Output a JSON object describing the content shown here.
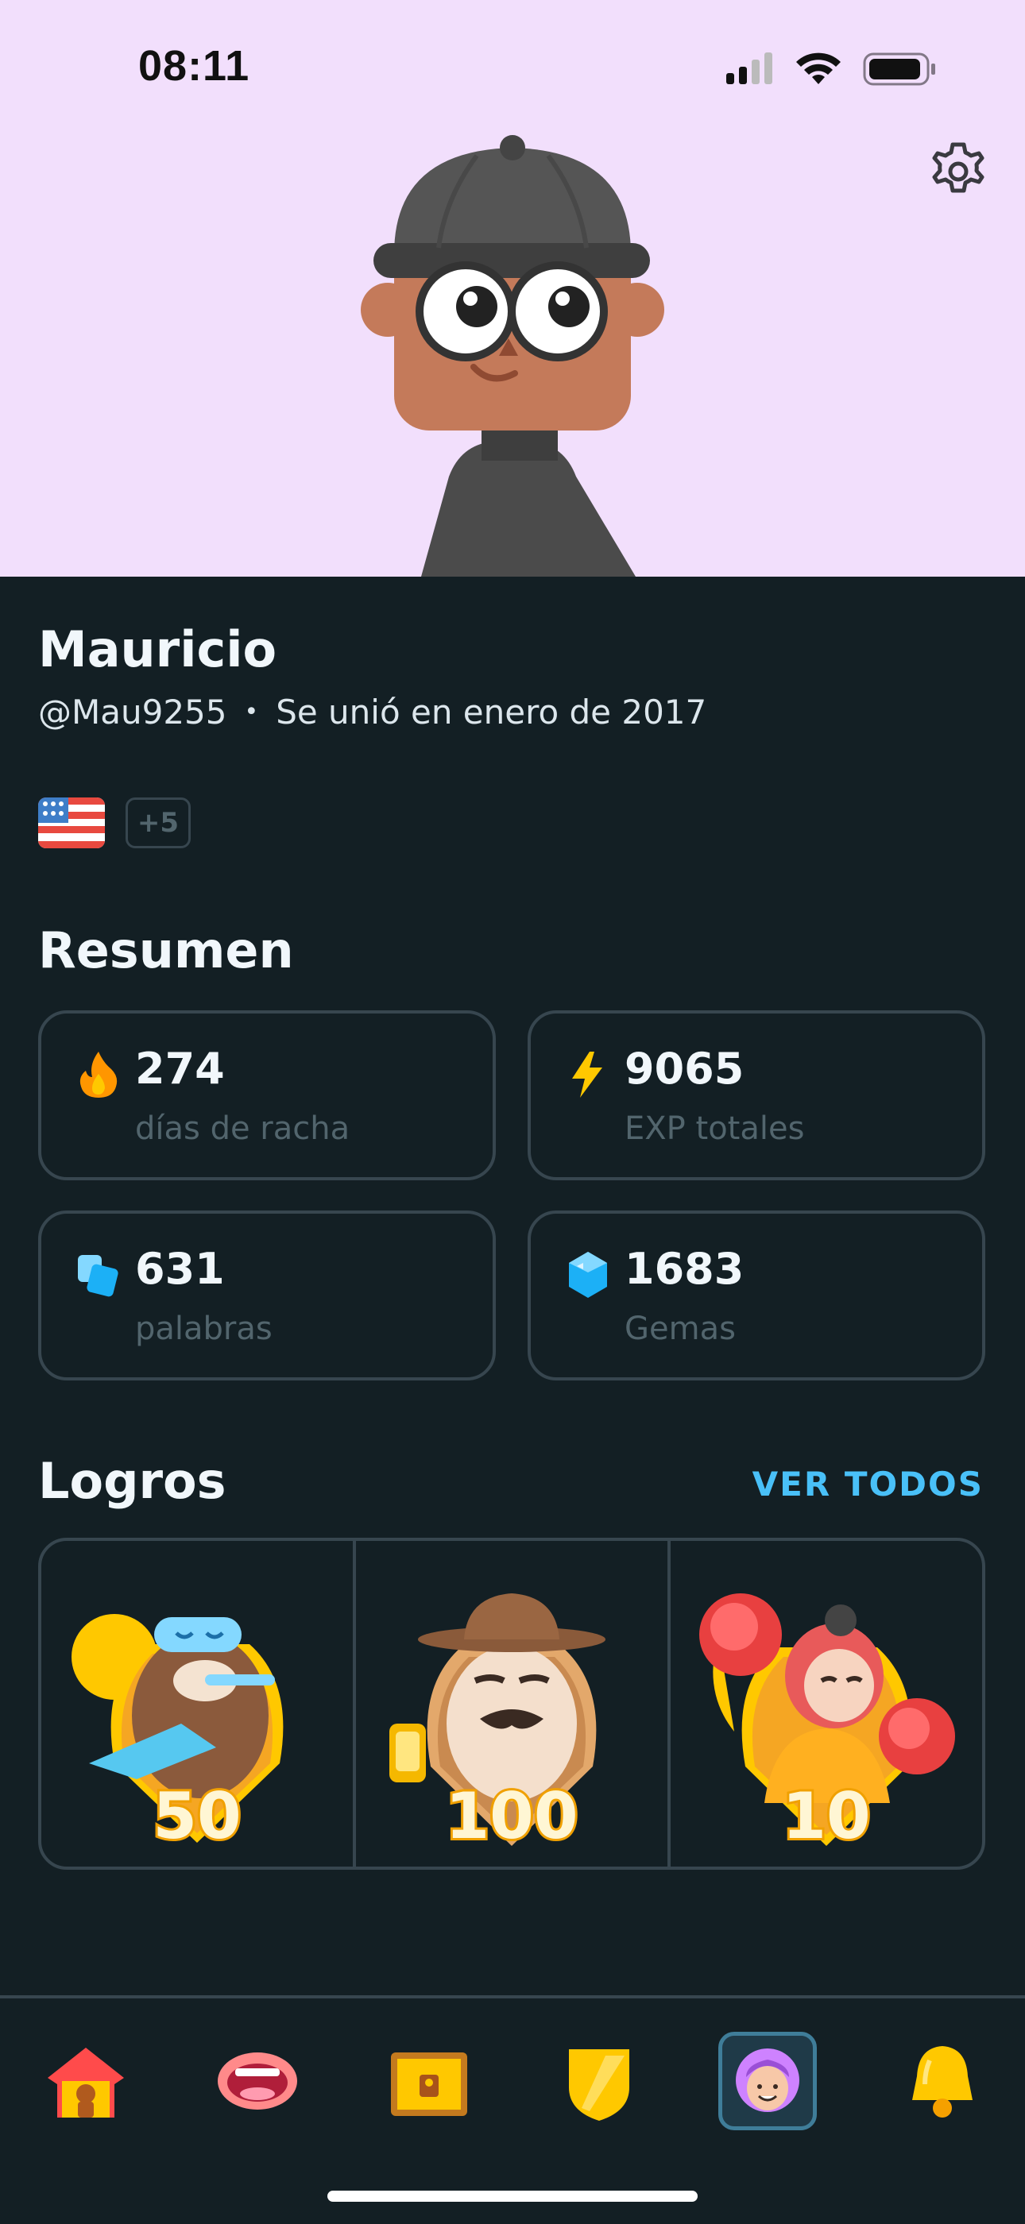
{
  "status_bar": {
    "time": "08:11"
  },
  "profile": {
    "name": "Mauricio",
    "username": "@Mau9255",
    "joined": "Se unió en enero de 2017",
    "separator": "•",
    "extra_courses_badge": "+5"
  },
  "summary": {
    "title": "Resumen",
    "stats": [
      {
        "icon": "flame-icon",
        "value": "274",
        "label": "días de racha"
      },
      {
        "icon": "lightning-icon",
        "value": "9065",
        "label": "EXP totales"
      },
      {
        "icon": "cards-icon",
        "value": "631",
        "label": "palabras"
      },
      {
        "icon": "gem-icon",
        "value": "1683",
        "label": "Gemas"
      }
    ]
  },
  "achievements": {
    "title": "Logros",
    "see_all": "VER TODOS",
    "items": [
      {
        "icon": "sleepy-bear-badge-icon",
        "level": "50"
      },
      {
        "icon": "explorer-badge-icon",
        "level": "100"
      },
      {
        "icon": "boxer-badge-icon",
        "level": "10"
      }
    ]
  },
  "tabbar": {
    "items": [
      {
        "icon": "home-icon"
      },
      {
        "icon": "speak-icon"
      },
      {
        "icon": "chest-icon"
      },
      {
        "icon": "shield-icon"
      },
      {
        "icon": "profile-icon",
        "active": true
      },
      {
        "icon": "bell-icon"
      }
    ]
  },
  "colors": {
    "hero_background": "#f2dffc",
    "page_background": "#131f24",
    "accent_link": "#49c0f8",
    "card_border": "#37464f"
  }
}
